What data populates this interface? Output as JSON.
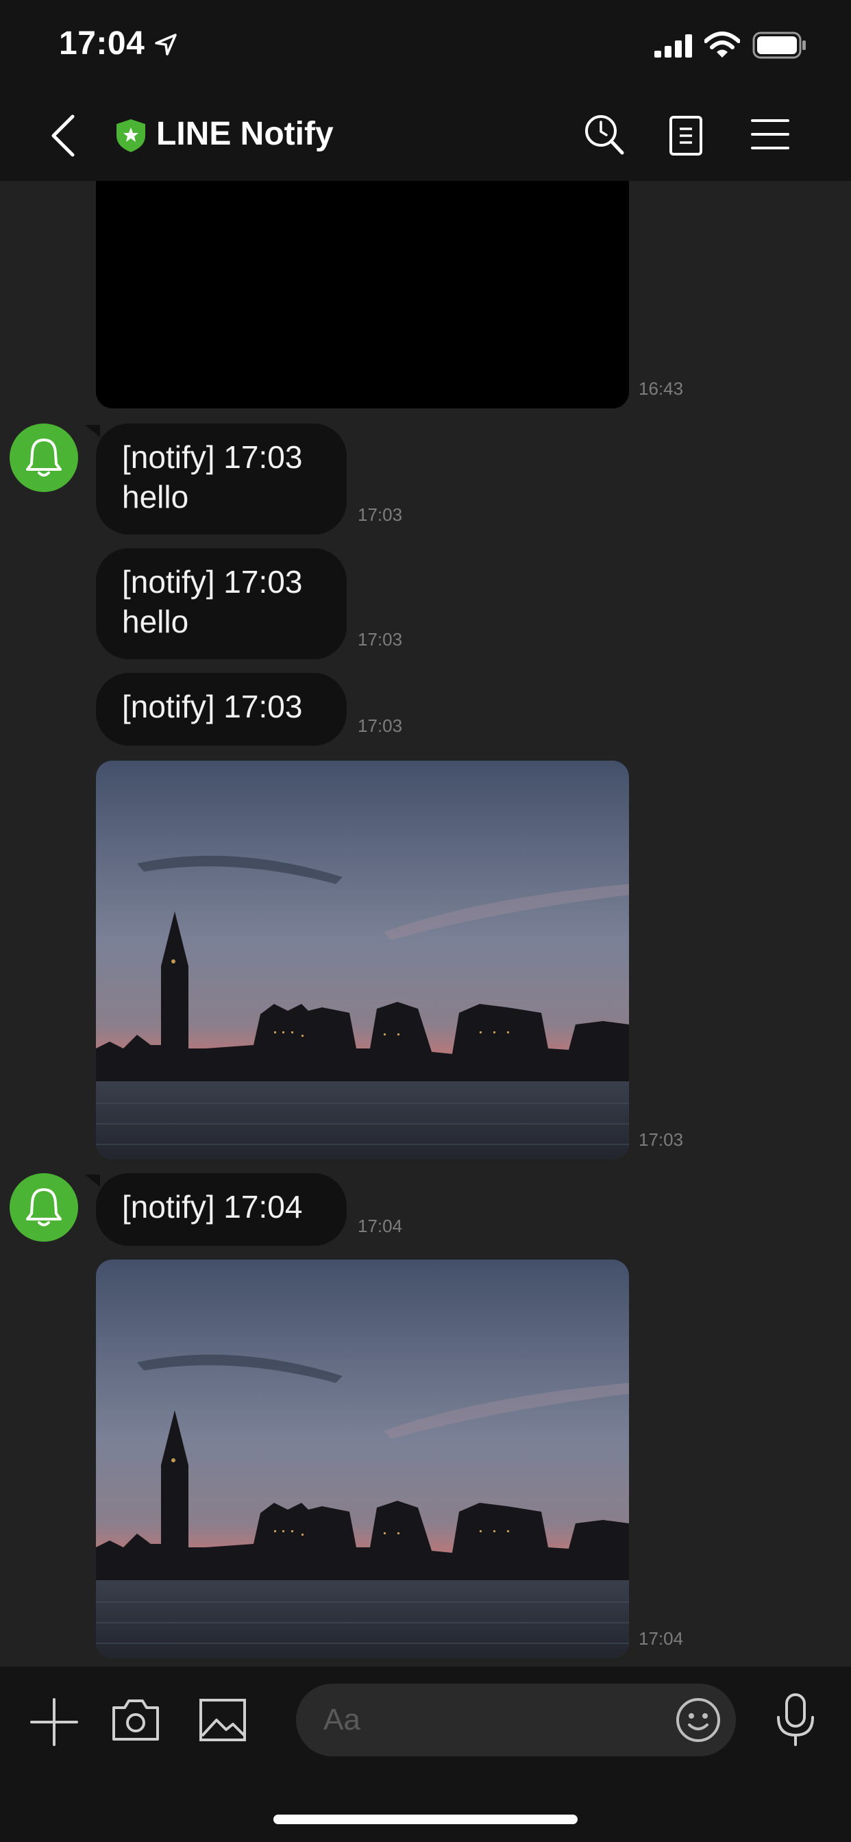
{
  "status": {
    "time": "17:04"
  },
  "nav": {
    "title": "LINE Notify"
  },
  "messages": {
    "top_image_time": "16:43",
    "m1": {
      "text": "[notify] 17:03\nhello",
      "time": "17:03"
    },
    "m2": {
      "text": "[notify] 17:03\nhello",
      "time": "17:03"
    },
    "m3": {
      "text": "[notify] 17:03",
      "time": "17:03"
    },
    "img1_time": "17:03",
    "m4": {
      "text": "[notify] 17:04",
      "time": "17:04"
    },
    "img2_time": "17:04"
  },
  "input": {
    "placeholder": "Aa"
  },
  "colors": {
    "accent": "#4cb434",
    "bubble": "#111111",
    "background": "#222222"
  },
  "icons": [
    "location-arrow-icon",
    "signal-icon",
    "wifi-icon",
    "battery-icon",
    "back-icon",
    "shield-icon",
    "search-icon",
    "notes-icon",
    "menu-icon",
    "bell-icon",
    "plus-icon",
    "camera-icon",
    "image-icon",
    "emoji-icon",
    "mic-icon"
  ]
}
